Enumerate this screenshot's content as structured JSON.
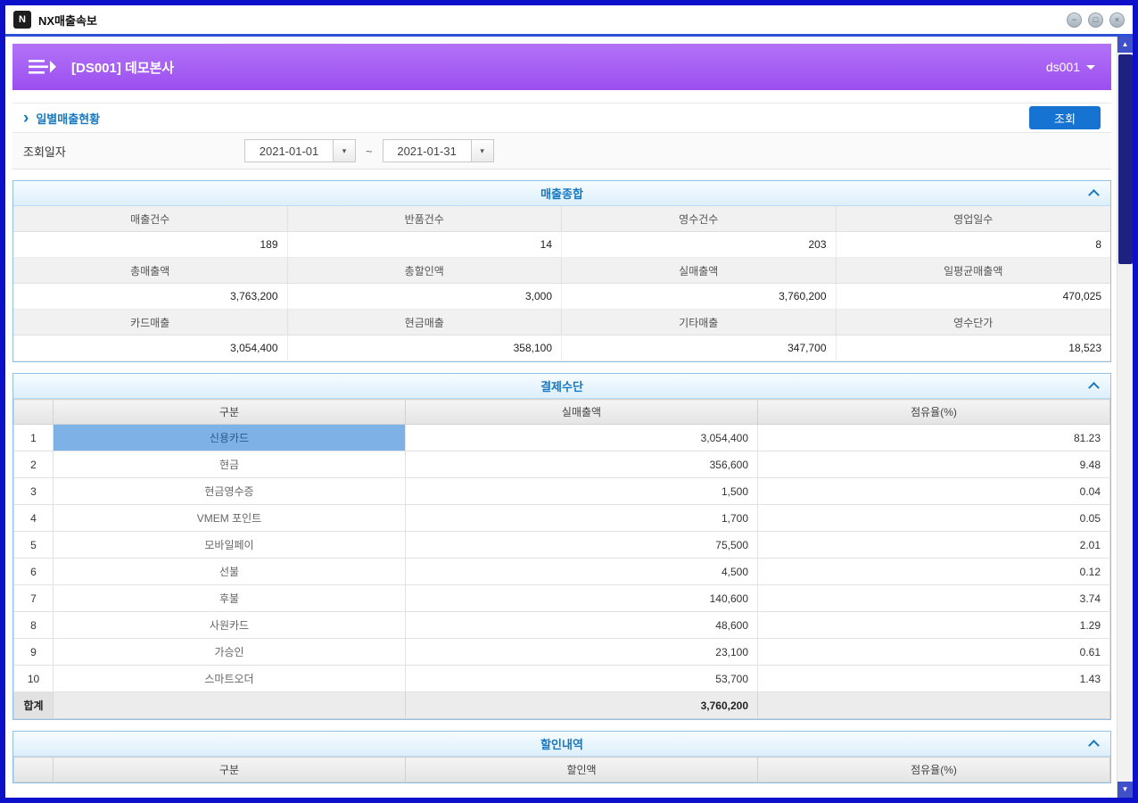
{
  "window": {
    "title": "NX매출속보",
    "app_icon": "N",
    "controls": {
      "minimize": "−",
      "maximize": "□",
      "close": "×"
    }
  },
  "header": {
    "title": "[DS001] 데모본사",
    "user": "ds001"
  },
  "toolbar": {
    "arrow": "›",
    "section_title": "일별매출현황",
    "search_button": "조회",
    "filter_label": "조회일자",
    "date_from": "2021-01-01",
    "date_to": "2021-01-31",
    "range_separator": "~",
    "dropdown_arrow": "▾"
  },
  "summary": {
    "title": "매출종합",
    "groups": [
      {
        "labels": [
          "매출건수",
          "반품건수",
          "영수건수",
          "영업일수"
        ],
        "values": [
          "189",
          "14",
          "203",
          "8"
        ]
      },
      {
        "labels": [
          "총매출액",
          "총할인액",
          "실매출액",
          "일평균매출액"
        ],
        "values": [
          "3,763,200",
          "3,000",
          "3,760,200",
          "470,025"
        ]
      },
      {
        "labels": [
          "카드매출",
          "현금매출",
          "기타매출",
          "영수단가"
        ],
        "values": [
          "3,054,400",
          "358,100",
          "347,700",
          "18,523"
        ]
      }
    ]
  },
  "payment": {
    "title": "결제수단",
    "columns": [
      "구분",
      "실매출액",
      "점유율(%)"
    ],
    "rows": [
      {
        "no": "1",
        "name": "신용카드",
        "amount": "3,054,400",
        "share": "81.23",
        "selected": true
      },
      {
        "no": "2",
        "name": "현금",
        "amount": "356,600",
        "share": "9.48",
        "selected": false
      },
      {
        "no": "3",
        "name": "현금영수증",
        "amount": "1,500",
        "share": "0.04",
        "selected": false
      },
      {
        "no": "4",
        "name": "VMEM 포인트",
        "amount": "1,700",
        "share": "0.05",
        "selected": false
      },
      {
        "no": "5",
        "name": "모바일페이",
        "amount": "75,500",
        "share": "2.01",
        "selected": false
      },
      {
        "no": "6",
        "name": "선불",
        "amount": "4,500",
        "share": "0.12",
        "selected": false
      },
      {
        "no": "7",
        "name": "후불",
        "amount": "140,600",
        "share": "3.74",
        "selected": false
      },
      {
        "no": "8",
        "name": "사원카드",
        "amount": "48,600",
        "share": "1.29",
        "selected": false
      },
      {
        "no": "9",
        "name": "가승인",
        "amount": "23,100",
        "share": "0.61",
        "selected": false
      },
      {
        "no": "10",
        "name": "스마트오더",
        "amount": "53,700",
        "share": "1.43",
        "selected": false
      }
    ],
    "total": {
      "label": "합계",
      "amount": "3,760,200"
    }
  },
  "discount": {
    "title": "할인내역",
    "columns": [
      "구분",
      "할인액",
      "점유율(%)"
    ]
  },
  "scrollbar": {
    "up_arrow": "▲",
    "down_arrow": "▼"
  },
  "colors": {
    "window_border": "#0c10c8",
    "accent_purple": "#a55ef2",
    "accent_blue": "#1673d2",
    "panel_title_blue": "#1778c2",
    "selected_cell": "#7eb1e6"
  }
}
